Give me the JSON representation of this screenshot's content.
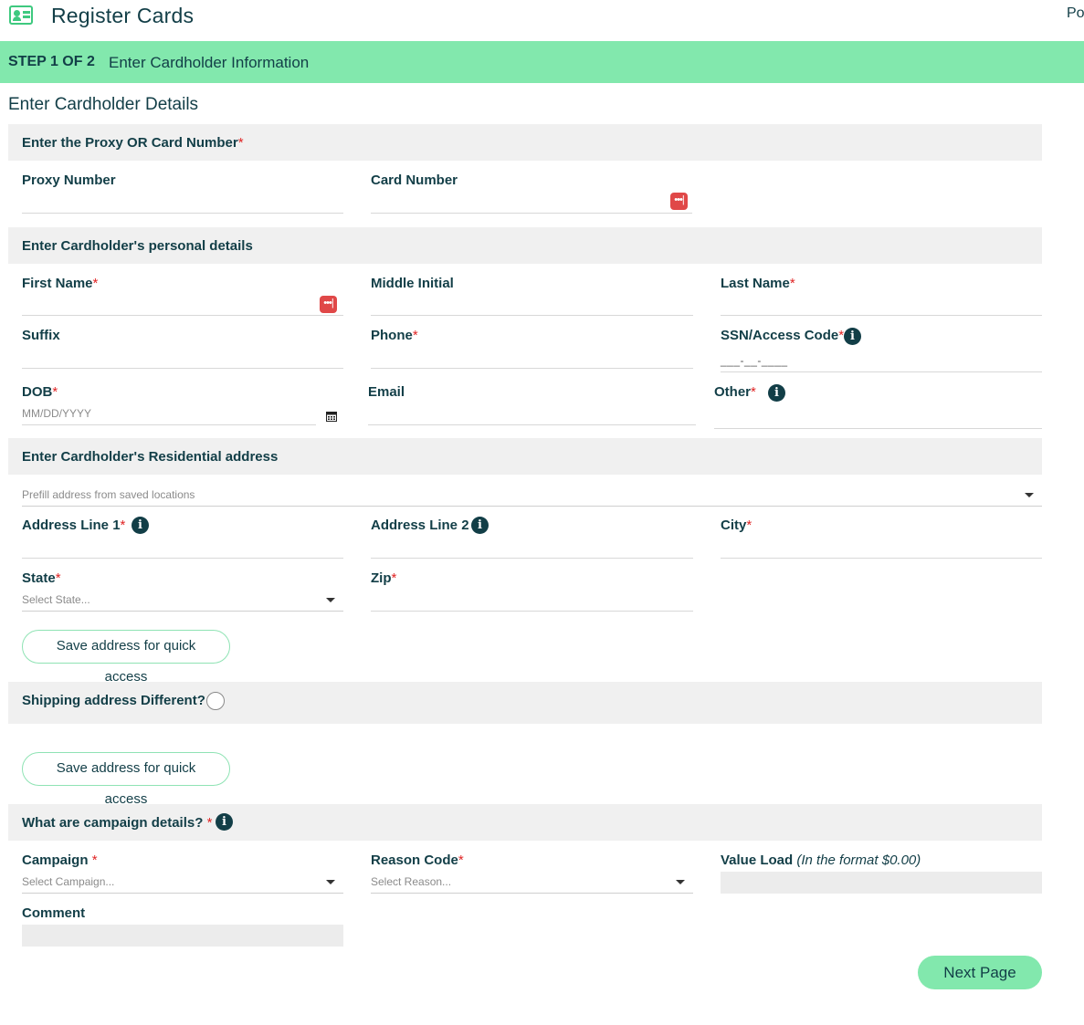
{
  "header": {
    "title": "Register Cards",
    "corner_text": "Po",
    "icon": "id-card-icon"
  },
  "step": {
    "label": "STEP 1 OF 2",
    "text": "Enter Cardholder Information"
  },
  "details_title": "Enter Cardholder Details",
  "card_section": {
    "title": "Enter the Proxy OR Card Number",
    "proxy_label": "Proxy Number",
    "card_label": "Card Number"
  },
  "personal_section": {
    "title": "Enter Cardholder's personal details",
    "first_name": "First Name",
    "middle_initial": "Middle Initial",
    "last_name": "Last Name",
    "suffix": "Suffix",
    "phone": "Phone",
    "ssn": "SSN/Access Code",
    "ssn_mask": "___-__-____",
    "dob": "DOB",
    "dob_placeholder": "MM/DD/YYYY",
    "email": "Email",
    "other": "Other"
  },
  "address_section": {
    "title": "Enter Cardholder's Residential address",
    "prefill_placeholder": "Prefill address from saved locations",
    "address1": "Address Line 1",
    "address2": "Address Line 2",
    "city": "City",
    "state": "State",
    "state_placeholder": "Select State...",
    "zip": "Zip",
    "save_button": "Save address for quick access"
  },
  "shipping_section": {
    "title": "Shipping address Different?",
    "save_button": "Save address for quick access"
  },
  "campaign_section": {
    "title": "What are campaign details?",
    "campaign": "Campaign ",
    "campaign_placeholder": "Select Campaign...",
    "reason": "Reason Code",
    "reason_placeholder": "Select Reason...",
    "value_load": "Value Load ",
    "value_load_hint": "(In the format $0.00)",
    "comment": "Comment"
  },
  "required_marker": "*",
  "next_button": "Next Page",
  "colors": {
    "accent": "#82e8ad",
    "text": "#123e47",
    "required": "#e02424",
    "password_icon": "#e04848"
  }
}
